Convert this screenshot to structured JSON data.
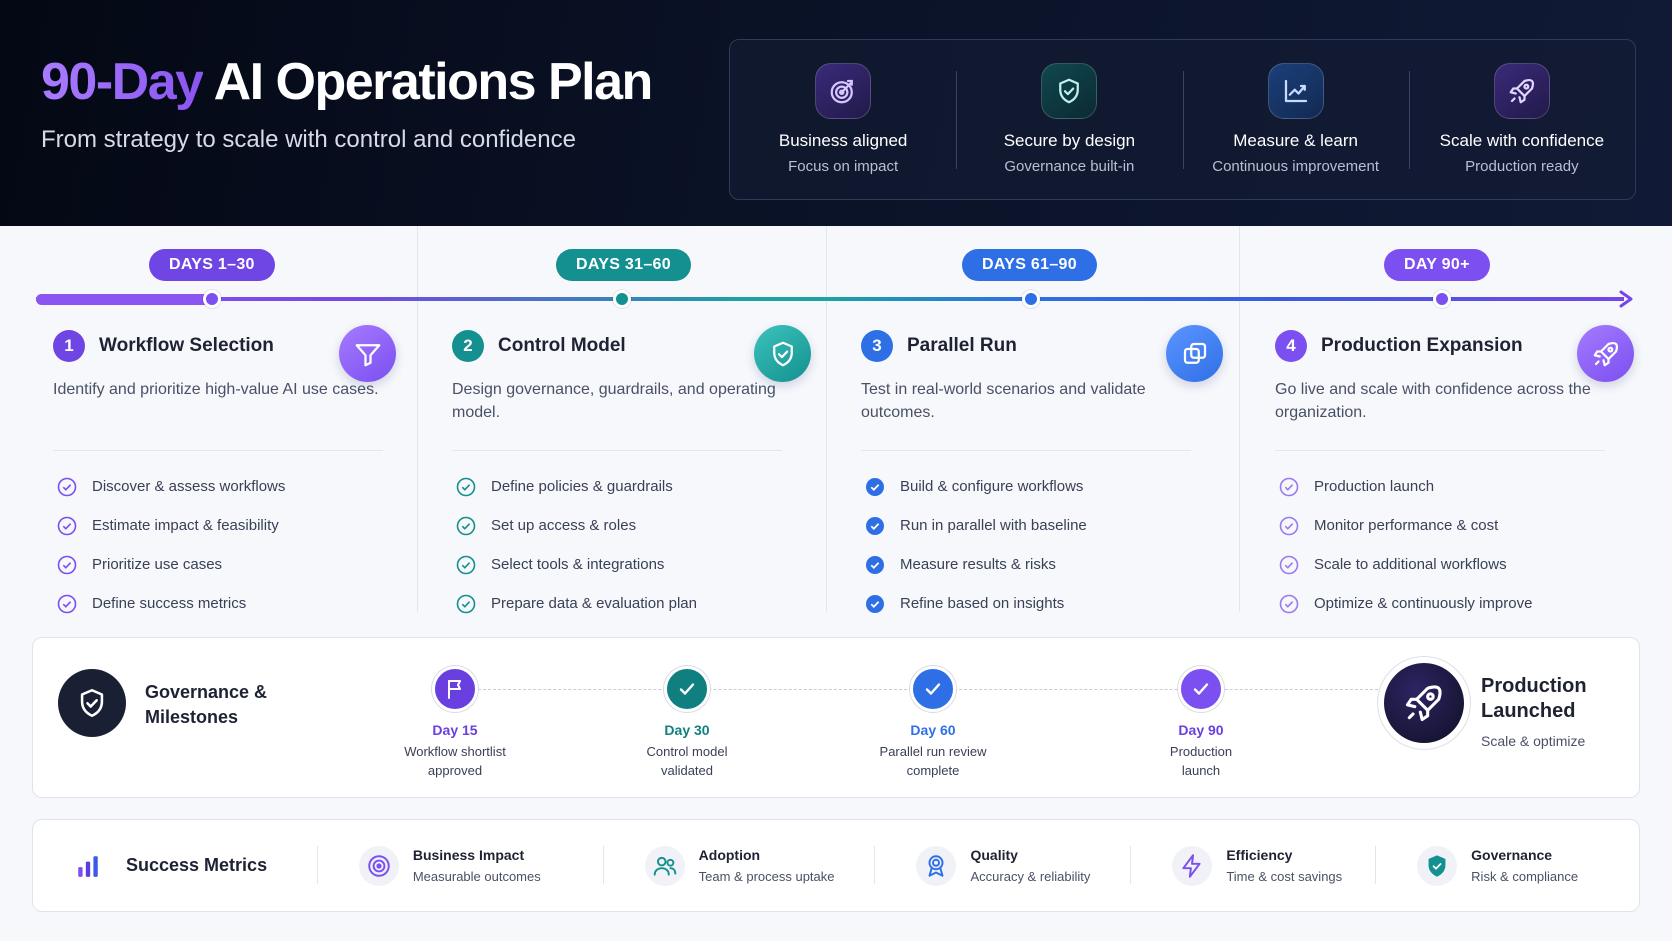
{
  "header": {
    "title_accent": "90-Day",
    "title_rest": "AI Operations Plan",
    "subtitle": "From strategy to scale with control and confidence",
    "pillars": [
      {
        "title": "Business aligned",
        "subtitle": "Focus on impact",
        "icon": "target-icon",
        "color": "#8a55f0"
      },
      {
        "title": "Secure by design",
        "subtitle": "Governance built-in",
        "icon": "shield-check-icon",
        "color": "#1aa3a3"
      },
      {
        "title": "Measure & learn",
        "subtitle": "Continuous improvement",
        "icon": "line-chart-icon",
        "color": "#3b7bf0"
      },
      {
        "title": "Scale with confidence",
        "subtitle": "Production ready",
        "icon": "rocket-icon",
        "color": "#8a55f0"
      }
    ]
  },
  "timeline": {
    "phases": [
      {
        "pill": "DAYS 1–30",
        "num": "1",
        "title": "Workflow Selection",
        "desc": "Identify and prioritize high-value AI use cases.",
        "color": "#7b4ff0",
        "icon": "funnel-icon",
        "items": [
          "Discover & assess workflows",
          "Estimate impact & feasibility",
          "Prioritize use cases",
          "Define success metrics"
        ]
      },
      {
        "pill": "DAYS 31–60",
        "num": "2",
        "title": "Control Model",
        "desc": "Design governance, guardrails, and operating model.",
        "color": "#13908f",
        "icon": "shield-check-icon",
        "items": [
          "Define policies & guardrails",
          "Set up access & roles",
          "Select tools & integrations",
          "Prepare data & evaluation plan"
        ]
      },
      {
        "pill": "DAYS 61–90",
        "num": "3",
        "title": "Parallel Run",
        "desc": "Test in real-world scenarios and validate outcomes.",
        "color": "#2f6fe6",
        "icon": "copy-icon",
        "items": [
          "Build & configure workflows",
          "Run in parallel with baseline",
          "Measure results & risks",
          "Refine based on insights"
        ]
      },
      {
        "pill": "DAY 90+",
        "num": "4",
        "title": "Production Expansion",
        "desc": "Go live and scale with confidence across the organization.",
        "color": "#7b4ff0",
        "icon": "rocket-icon",
        "items": [
          "Production launch",
          "Monitor performance & cost",
          "Scale to additional workflows",
          "Optimize & continuously improve"
        ]
      }
    ]
  },
  "governance": {
    "title": "Governance & Milestones",
    "milestones": [
      {
        "day": "Day 15",
        "desc": "Workflow shortlist approved",
        "color": "#6a3fe0",
        "icon": "flag-icon"
      },
      {
        "day": "Day 30",
        "desc": "Control model validated",
        "color": "#0f7f80",
        "icon": "check-icon"
      },
      {
        "day": "Day 60",
        "desc": "Parallel run review complete",
        "color": "#2f6fe6",
        "icon": "check-icon"
      },
      {
        "day": "Day 90",
        "desc": "Production launch",
        "color": "#7b4ff0",
        "icon": "check-icon"
      }
    ],
    "launch_title": "Production Launched",
    "launch_sub": "Scale & optimize"
  },
  "metrics": {
    "title": "Success Metrics",
    "items": [
      {
        "title": "Business Impact",
        "sub": "Measurable outcomes",
        "icon": "target-icon",
        "color": "#7b4ff0"
      },
      {
        "title": "Adoption",
        "sub": "Team & process uptake",
        "icon": "users-icon",
        "color": "#13908f"
      },
      {
        "title": "Quality",
        "sub": "Accuracy & reliability",
        "icon": "award-icon",
        "color": "#2f6fe6"
      },
      {
        "title": "Efficiency",
        "sub": "Time & cost savings",
        "icon": "lightning-icon",
        "color": "#7b4ff0"
      },
      {
        "title": "Governance",
        "sub": "Risk & compliance",
        "icon": "shield-check-icon",
        "color": "#13908f"
      }
    ]
  }
}
